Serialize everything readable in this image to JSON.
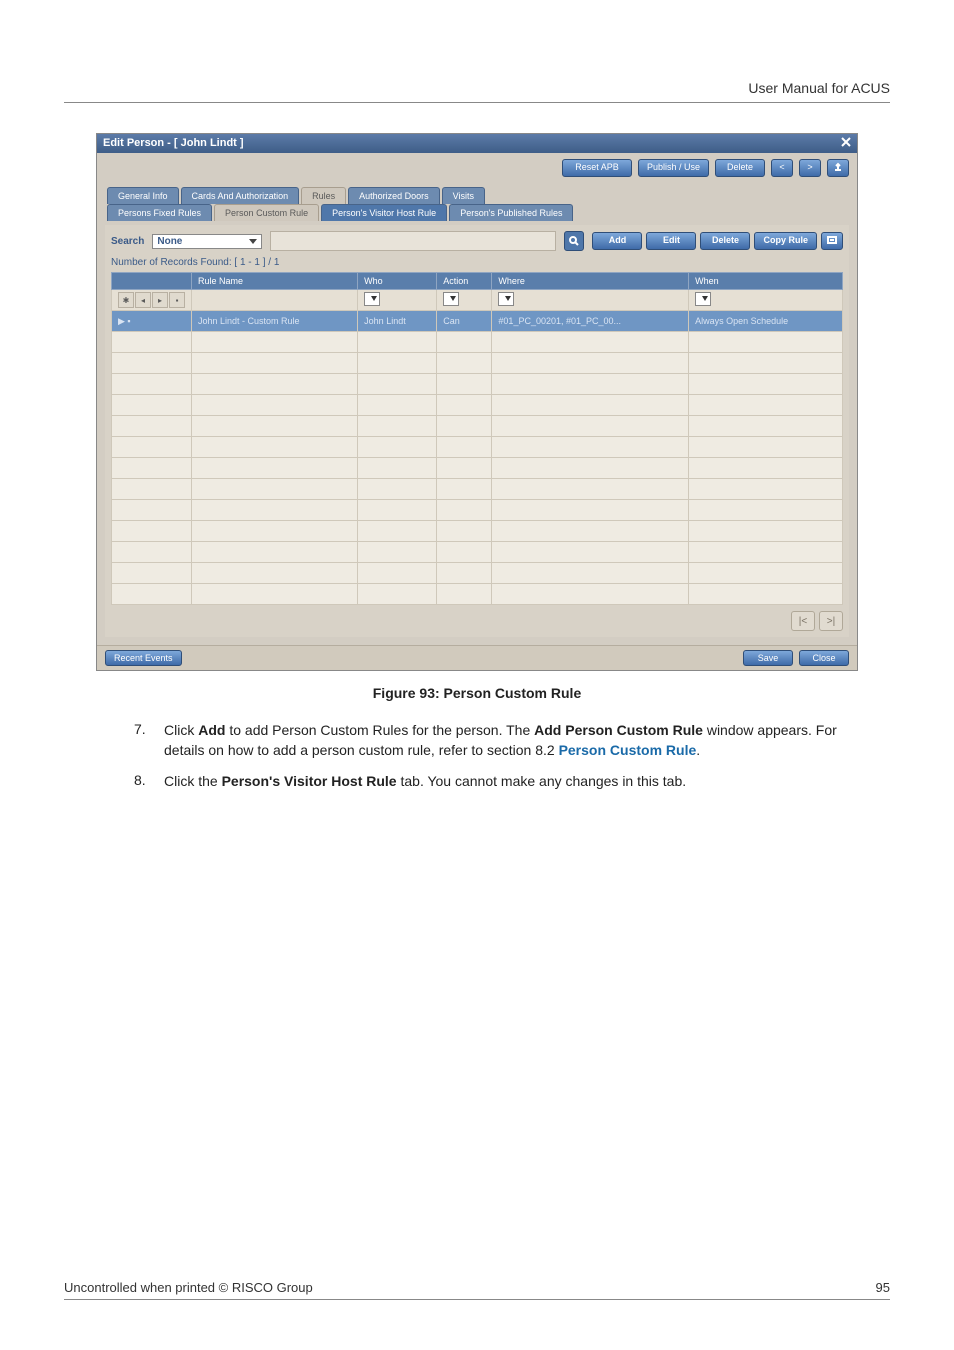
{
  "header": {
    "title": "User Manual for ACUS"
  },
  "screenshot": {
    "window_title": "Edit Person - [ John Lindt ]",
    "top_buttons": {
      "read_apb": "Reset APB",
      "publish": "Publish / Use",
      "delete": "Delete",
      "nav_prev": "<",
      "nav_next": ">"
    },
    "tabs_main": [
      "General Info",
      "Cards And Authorization",
      "Rules",
      "Authorized Doors",
      "Visits"
    ],
    "tabs_sub": [
      "Persons Fixed Rules",
      "Person Custom Rule",
      "Person's Visitor Host Rule",
      "Person's Published Rules"
    ],
    "search": {
      "label": "Search",
      "value": "None"
    },
    "row_actions": {
      "add": "Add",
      "edit": "Edit",
      "delete": "Delete",
      "copy": "Copy Rule"
    },
    "records_label": "Number of Records Found: [ 1 - 1 ] / 1",
    "grid": {
      "columns": [
        "",
        "Rule Name",
        "Who",
        "Action",
        "Where",
        "When"
      ],
      "row": {
        "name": "John Lindt - Custom Rule",
        "who": "John Lindt",
        "action": "Can",
        "where": "#01_PC_00201, #01_PC_00...",
        "when": "Always Open Schedule"
      }
    },
    "status": {
      "label": "Recent Events",
      "save": "Save",
      "close": "Close"
    }
  },
  "caption": "Figure 93: Person Custom Rule",
  "steps": [
    {
      "num": "7.",
      "pre": "Click ",
      "b1": "Add",
      "mid1": " to add Person Custom Rules for the person. The ",
      "b2": "Add Person Custom Rule",
      "mid2": " window appears. For details on how to add a person custom rule, refer to section 8.2 ",
      "link": "Person Custom Rule",
      "post": "."
    },
    {
      "num": "8.",
      "pre": "Click the ",
      "b1": "Person's Visitor Host Rule",
      "mid1": " tab. You cannot make any changes in this tab.",
      "b2": "",
      "mid2": "",
      "link": "",
      "post": ""
    }
  ],
  "footer": {
    "left": "Uncontrolled when printed © RISCO Group",
    "right": "95"
  }
}
